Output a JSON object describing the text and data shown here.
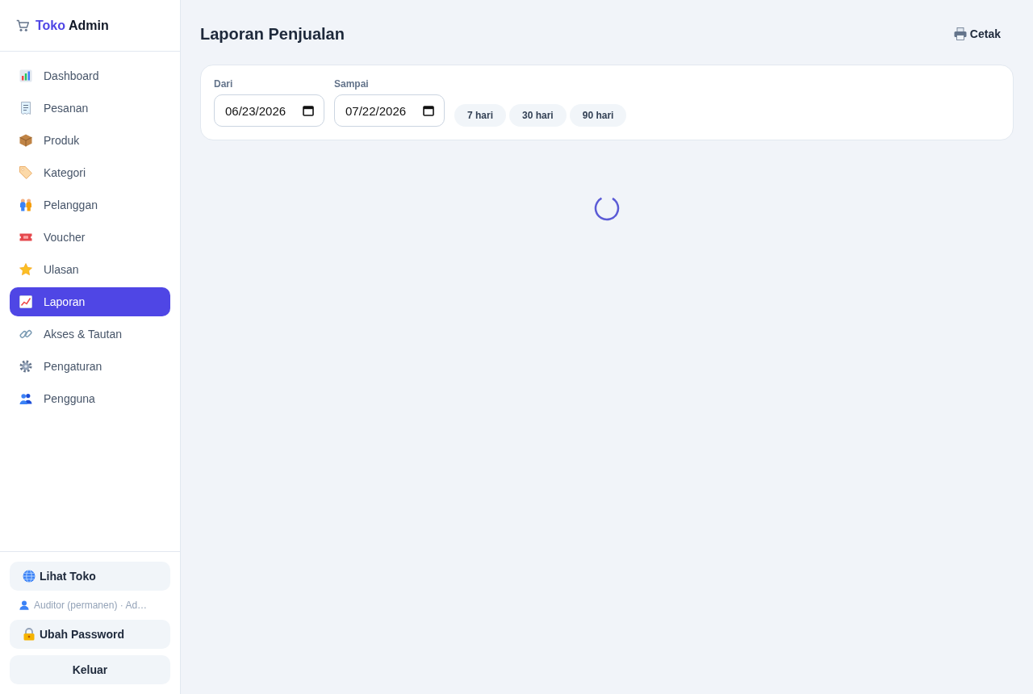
{
  "sidebar": {
    "brand": {
      "accent": "Toko",
      "rest": "Admin"
    },
    "items": [
      {
        "label": "Dashboard",
        "selected": false
      },
      {
        "label": "Pesanan",
        "selected": false
      },
      {
        "label": "Produk",
        "selected": false
      },
      {
        "label": "Kategori",
        "selected": false
      },
      {
        "label": "Pelanggan",
        "selected": false
      },
      {
        "label": "Voucher",
        "selected": false
      },
      {
        "label": "Ulasan",
        "selected": false
      },
      {
        "label": "Laporan",
        "selected": true
      },
      {
        "label": "Akses & Tautan",
        "selected": false
      },
      {
        "label": "Pengaturan",
        "selected": false
      },
      {
        "label": "Pengguna",
        "selected": false
      }
    ],
    "footer": {
      "store_link": "Lihat Toko",
      "user": "Auditor (permanen) · Ad…",
      "change_password": "Ubah Password",
      "logout": "Keluar"
    }
  },
  "header": {
    "title": "Laporan Penjualan",
    "print_button": "Cetak"
  },
  "filters": {
    "fields": [
      {
        "label": "Dari",
        "value": "06/23/2026"
      },
      {
        "label": "Sampai",
        "value": "07/22/2026"
      }
    ],
    "presets": [
      {
        "label": "7 hari",
        "selected": false
      },
      {
        "label": "30 hari",
        "selected": false
      },
      {
        "label": "90 hari",
        "selected": false
      }
    ]
  },
  "loading": true
}
